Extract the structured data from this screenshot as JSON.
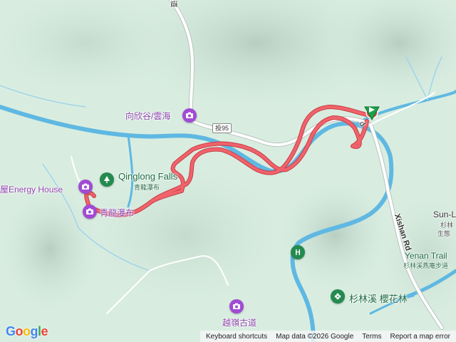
{
  "map": {
    "labels": {
      "energy_house": "屋Energy House",
      "qinglong_falls": "Qinglong Falls",
      "qinglong_falls_zh": "青龍瀑布",
      "xiangxin_valley": "向欣谷/雲海",
      "route_95": "投95",
      "xishan_rd": "Xishan Rd",
      "yenan_trail": "Yenan Trail",
      "yenan_trail_zh": "杉林溪燕庵步道",
      "sun_link": "Sun-L",
      "sun_link_zh1": "杉林",
      "sun_link_zh2": "生態",
      "shanlinxi_cherry": "杉林溪 櫻花林",
      "yueling_trail": "越嶺古道",
      "bottom_left_poi": "青龍瀑布",
      "road_top": "道",
      "road_near_start": "d"
    },
    "attribution": {
      "shortcuts": "Keyboard shortcuts",
      "map_data": "Map data ©2026 Google",
      "terms": "Terms",
      "report": "Report a map error"
    },
    "logo": "Google",
    "colors": {
      "track": "#f0636b",
      "track_outline": "#c83c46",
      "river": "#5fb8e2",
      "road": "#ffffff",
      "start_pin": "#1aa34a",
      "end_pin": "#e74c3c"
    }
  }
}
